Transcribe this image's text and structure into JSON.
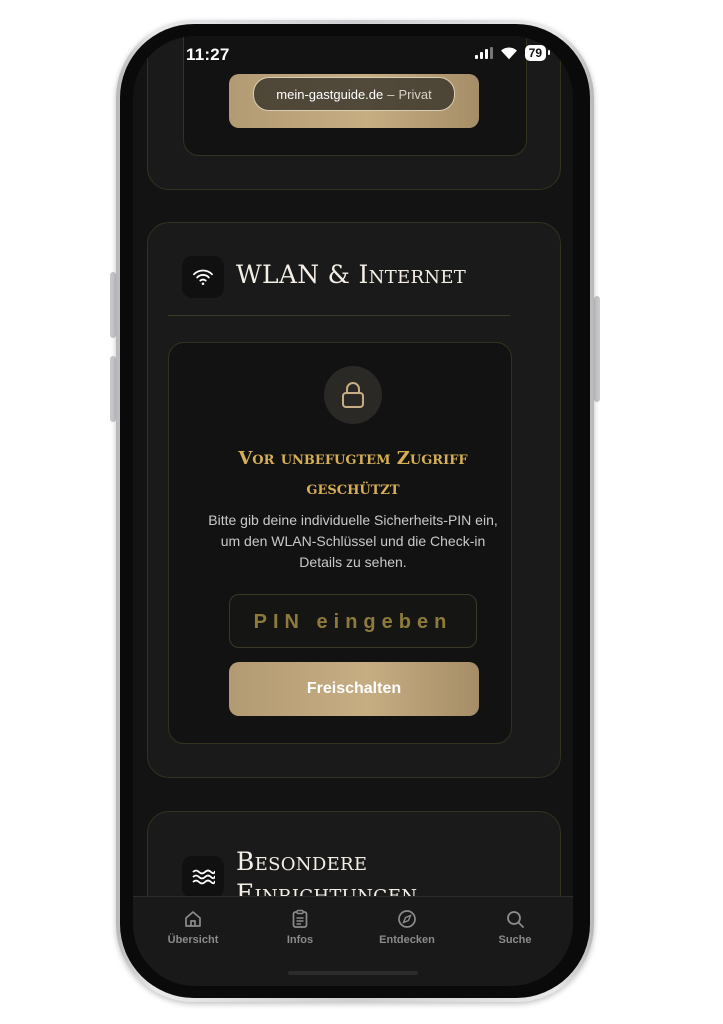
{
  "status_bar": {
    "time": "11:27",
    "battery": "79"
  },
  "browser": {
    "domain": "mein-gastguide.de",
    "separator": "–",
    "mode": "Privat"
  },
  "wlan_section": {
    "title": "WLAN & Internet",
    "lock": {
      "headline": "Vor unbefugtem Zugriff geschützt",
      "description": "Bitte gib deine individuelle Sicherheits-PIN ein, um den WLAN-Schlüssel und die Check-in Details zu sehen.",
      "pin_placeholder": "PIN eingeben",
      "unlock_label": "Freischalten"
    }
  },
  "next_section": {
    "title": "Besondere Einrichtungen"
  },
  "tabbar": {
    "items": [
      {
        "label": "Übersicht",
        "icon": "home-icon"
      },
      {
        "label": "Infos",
        "icon": "clipboard-icon"
      },
      {
        "label": "Entdecken",
        "icon": "compass-icon"
      },
      {
        "label": "Suche",
        "icon": "search-icon"
      }
    ]
  },
  "colors": {
    "gold": "#c7ad82",
    "accent_text": "#d5ae56",
    "background": "#131313"
  }
}
